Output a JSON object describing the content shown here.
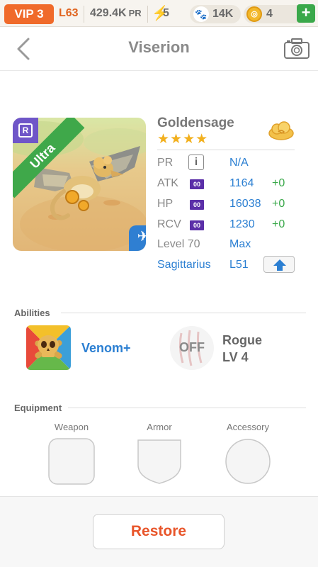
{
  "status_bar": {
    "vip": "VIP 3",
    "level": "L63",
    "pr_value": "429.4K",
    "pr_unit": "PR",
    "energy": "5",
    "paw": "14K",
    "coins": "4",
    "colors": {
      "vip_bg": "#f06a2a",
      "plus_bg": "#3aa84a"
    }
  },
  "header": {
    "title": "Viserion",
    "back_icon": "chevron-left-icon",
    "camera_icon": "camera-icon"
  },
  "monster": {
    "rarity_letter": "R",
    "rarity_label": "Ultra",
    "name": "Goldensage",
    "stars": "★★★★",
    "star_count": 4,
    "element_icon": "cloud-icon",
    "class_icon": "airplane-icon",
    "stats": [
      {
        "label": "PR",
        "value": "N/A",
        "bonus": ""
      },
      {
        "label": "ATK",
        "badge": "00",
        "value": "1164",
        "bonus": "+0"
      },
      {
        "label": "HP",
        "badge": "00",
        "value": "16038",
        "bonus": "+0"
      },
      {
        "label": "RCV",
        "badge": "00",
        "value": "1230",
        "bonus": "+0"
      }
    ],
    "level_label": "Level 70",
    "level_value": "Max",
    "sign": "Sagittarius",
    "sign_level": "L51"
  },
  "abilities": {
    "title": "Abilities",
    "active": "Venom+",
    "passive_state": "OFF",
    "passive_name": "Rogue",
    "passive_level": "LV 4"
  },
  "equipment": {
    "title": "Equipment",
    "slots": [
      "Weapon",
      "Armor",
      "Accessory"
    ]
  },
  "footer": {
    "restore": "Restore",
    "colors": {
      "restore_text": "#e8552a"
    }
  }
}
